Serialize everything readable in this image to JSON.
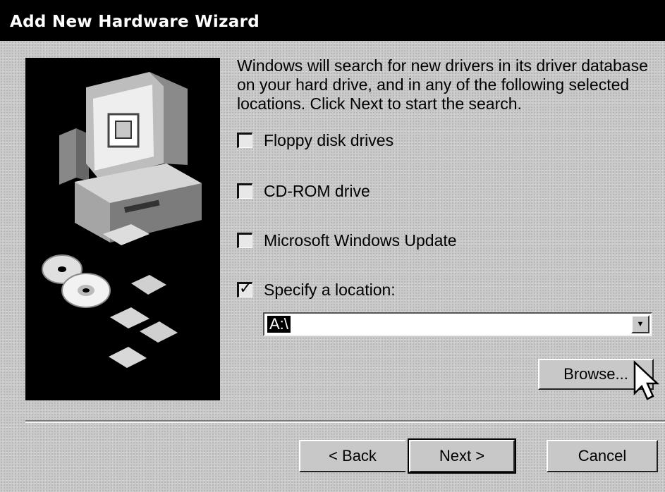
{
  "window": {
    "title": "Add New Hardware Wizard"
  },
  "intro_text": "Windows will search for new drivers in its driver database on your hard drive, and in any of the following selected locations. Click Next to start the search.",
  "options": [
    {
      "label": "Floppy disk drives",
      "checked": false
    },
    {
      "label": "CD-ROM drive",
      "checked": false
    },
    {
      "label": "Microsoft Windows Update",
      "checked": false
    },
    {
      "label": "Specify a location:",
      "checked": true
    }
  ],
  "location": {
    "value": "A:\\"
  },
  "buttons": {
    "browse": "Browse...",
    "back": "< Back",
    "next": "Next >",
    "cancel": "Cancel"
  },
  "icons": {
    "illustration": "computer-and-discs-illustration",
    "dropdown": "dropdown-arrow-icon",
    "cursor": "mouse-pointer-icon"
  }
}
